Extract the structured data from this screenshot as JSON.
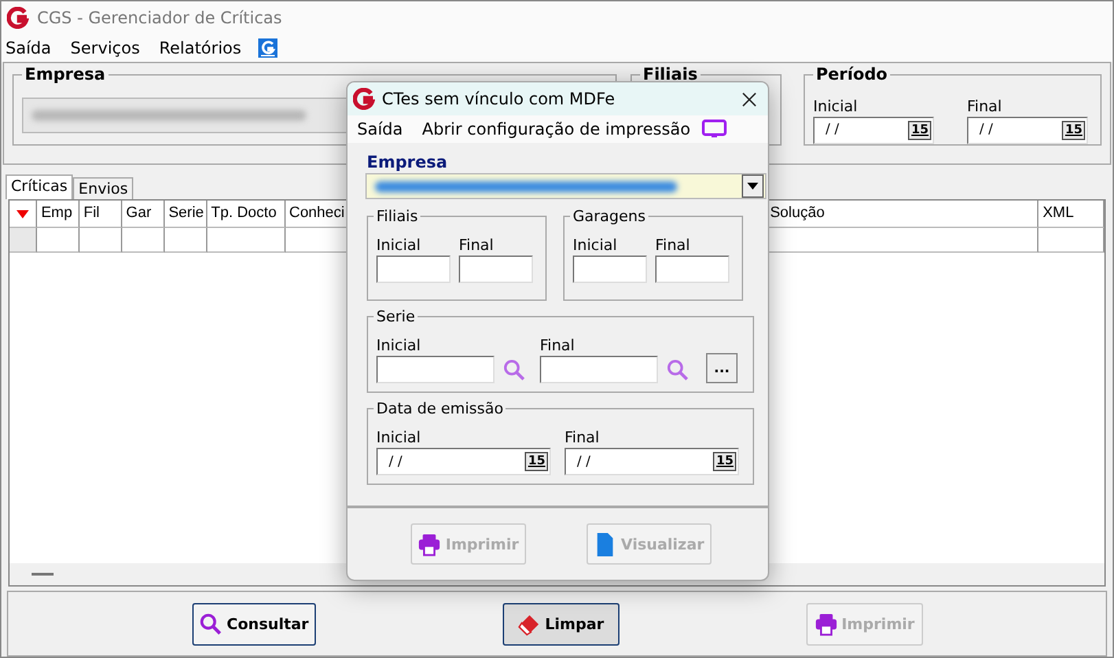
{
  "window": {
    "title": "CGS - Gerenciador de Críticas"
  },
  "menu": [
    "Saída",
    "Serviços",
    "Relatórios"
  ],
  "filters": {
    "empresa_label": "Empresa",
    "filiais_label": "Filiais",
    "periodo": {
      "label": "Período",
      "fields": [
        {
          "label": "Inicial",
          "value": "/ /",
          "calendar": "15"
        },
        {
          "label": "Final",
          "value": "/ /",
          "calendar": "15"
        }
      ]
    }
  },
  "tabs": [
    {
      "label": "Críticas",
      "selected": true
    },
    {
      "label": "Envios",
      "selected": false
    }
  ],
  "table": {
    "columns": [
      "Emp",
      "Fil",
      "Gar",
      "Serie",
      "Tp. Docto",
      "Conheci",
      "Solução",
      "XML"
    ]
  },
  "buttons": [
    {
      "label": "Consultar",
      "kind": "search",
      "disabled": false,
      "pressed": false
    },
    {
      "label": "Limpar",
      "kind": "clear",
      "disabled": false,
      "pressed": true
    },
    {
      "label": "Imprimir",
      "kind": "print",
      "disabled": true,
      "pressed": false
    }
  ],
  "dialog": {
    "title": "CTes sem vínculo com MDFe",
    "menu": [
      "Saída",
      "Abrir configuração de impressão"
    ],
    "empresa_label": "Empresa",
    "filiais": {
      "label": "Filiais",
      "fields": [
        "Inicial",
        "Final"
      ]
    },
    "garagens": {
      "label": "Garagens",
      "fields": [
        "Inicial",
        "Final"
      ]
    },
    "serie": {
      "label": "Serie",
      "fields": [
        "Inicial",
        "Final"
      ],
      "more": "..."
    },
    "data_emissao": {
      "label": "Data de emissão",
      "fields": [
        {
          "label": "Inicial",
          "value": "/ /",
          "calendar": "15"
        },
        {
          "label": "Final",
          "value": "/ /",
          "calendar": "15"
        }
      ]
    },
    "buttons": [
      {
        "label": "Imprimir",
        "kind": "print",
        "disabled": true
      },
      {
        "label": "Visualizar",
        "kind": "preview",
        "disabled": true
      }
    ]
  }
}
